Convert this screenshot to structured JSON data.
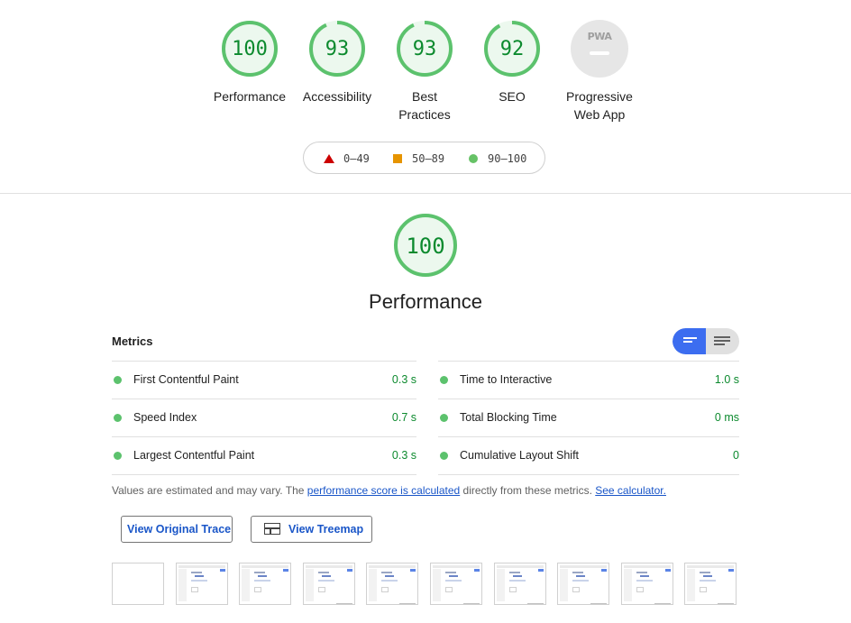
{
  "categories": [
    {
      "score": "100",
      "label": "Performance",
      "fraction": 1.0
    },
    {
      "score": "93",
      "label": "Accessibility",
      "fraction": 0.93
    },
    {
      "score": "93",
      "label": "Best Practices",
      "label_lines": [
        "Best",
        "Practices"
      ],
      "fraction": 0.93
    },
    {
      "score": "92",
      "label": "SEO",
      "fraction": 0.92
    },
    {
      "score": "",
      "label": "Progressive Web App",
      "label_lines": [
        "Progressive",
        "Web App"
      ],
      "badge": "PWA"
    }
  ],
  "legend": {
    "fail": "0–49",
    "average": "50–89",
    "pass": "90–100"
  },
  "performance": {
    "score": "100",
    "title": "Performance",
    "fraction": 1.0
  },
  "metrics": {
    "heading": "Metrics",
    "left": [
      {
        "name": "First Contentful Paint",
        "value": "0.3 s"
      },
      {
        "name": "Speed Index",
        "value": "0.7 s"
      },
      {
        "name": "Largest Contentful Paint",
        "value": "0.3 s"
      }
    ],
    "right": [
      {
        "name": "Time to Interactive",
        "value": "1.0 s"
      },
      {
        "name": "Total Blocking Time",
        "value": "0 ms"
      },
      {
        "name": "Cumulative Layout Shift",
        "value": "0"
      }
    ]
  },
  "note": {
    "prefix": "Values are estimated and may vary. The ",
    "link1": "performance score is calculated",
    "middle": " directly from these metrics. ",
    "link2": "See calculator."
  },
  "buttons": {
    "trace": "View Original Trace",
    "treemap": "View Treemap"
  },
  "colors": {
    "pass": "#0c8a2e",
    "pass_fill": "#5cc26d",
    "average": "#e69400",
    "fail": "#cc0000",
    "link": "#1a56c8",
    "toggle_active": "#3c6df0"
  }
}
